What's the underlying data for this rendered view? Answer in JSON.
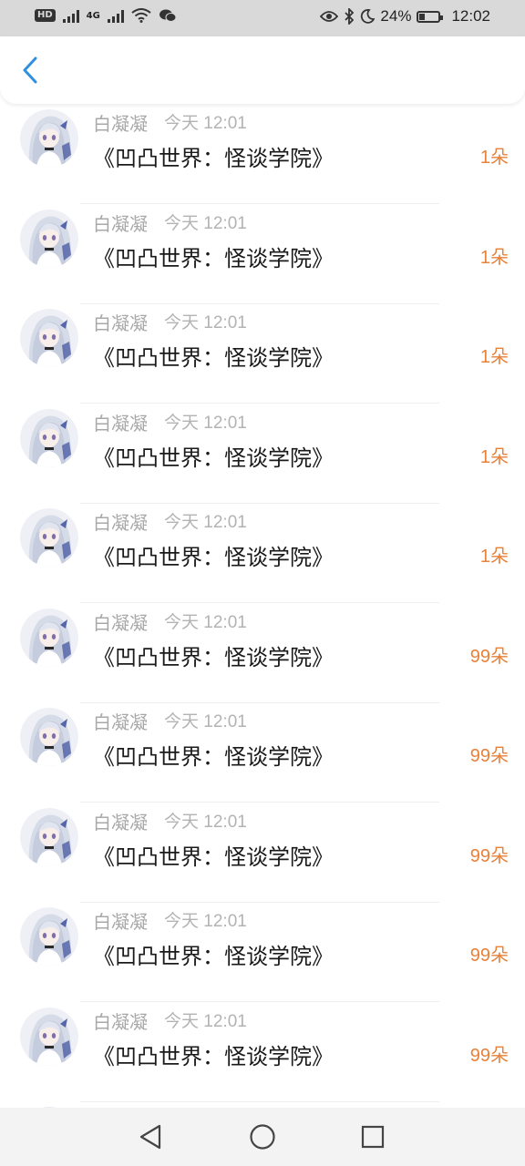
{
  "status_bar": {
    "hd_label": "HD",
    "network_label": "4G",
    "battery_text": "24%",
    "time": "12:02"
  },
  "header": {
    "back_icon": "chevron-left-icon",
    "accent_color": "#2f8fe0"
  },
  "list": {
    "items": [
      {
        "sender": "白凝凝",
        "time": "今天 12:01",
        "title": "《凹凸世界：怪谈学院》",
        "amount": "1朵"
      },
      {
        "sender": "白凝凝",
        "time": "今天 12:01",
        "title": "《凹凸世界：怪谈学院》",
        "amount": "1朵"
      },
      {
        "sender": "白凝凝",
        "time": "今天 12:01",
        "title": "《凹凸世界：怪谈学院》",
        "amount": "1朵"
      },
      {
        "sender": "白凝凝",
        "time": "今天 12:01",
        "title": "《凹凸世界：怪谈学院》",
        "amount": "1朵"
      },
      {
        "sender": "白凝凝",
        "time": "今天 12:01",
        "title": "《凹凸世界：怪谈学院》",
        "amount": "1朵"
      },
      {
        "sender": "白凝凝",
        "time": "今天 12:01",
        "title": "《凹凸世界：怪谈学院》",
        "amount": "99朵"
      },
      {
        "sender": "白凝凝",
        "time": "今天 12:01",
        "title": "《凹凸世界：怪谈学院》",
        "amount": "99朵"
      },
      {
        "sender": "白凝凝",
        "time": "今天 12:01",
        "title": "《凹凸世界：怪谈学院》",
        "amount": "99朵"
      },
      {
        "sender": "白凝凝",
        "time": "今天 12:01",
        "title": "《凹凸世界：怪谈学院》",
        "amount": "99朵"
      },
      {
        "sender": "白凝凝",
        "time": "今天 12:01",
        "title": "《凹凸世界：怪谈学院》",
        "amount": "99朵"
      }
    ],
    "amount_color": "#e8813a"
  },
  "nav_bar": {
    "back_icon": "triangle-back-icon",
    "home_icon": "circle-home-icon",
    "recents_icon": "square-recents-icon"
  }
}
